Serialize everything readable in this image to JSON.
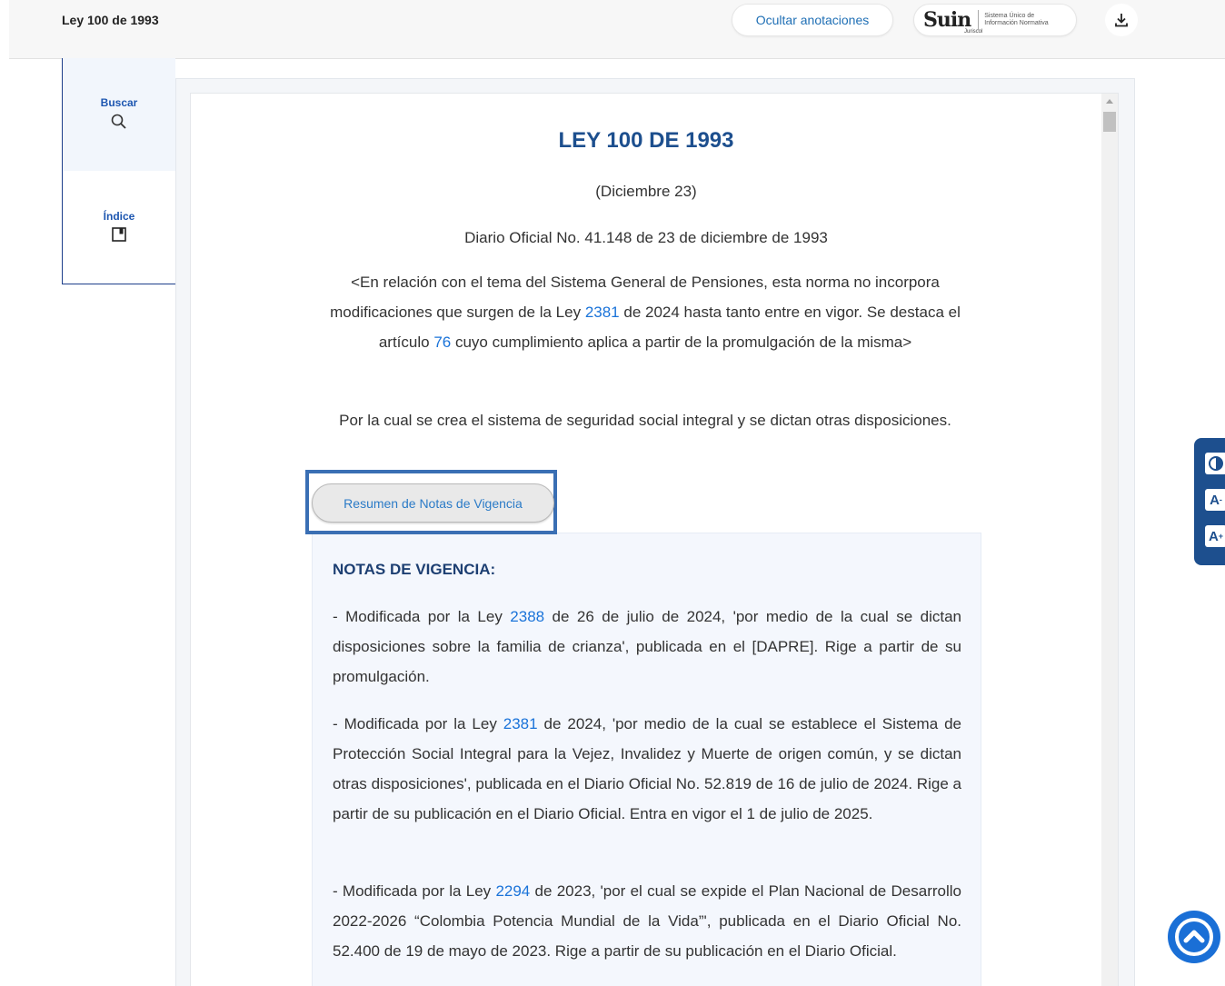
{
  "header": {
    "title": "Ley 100 de 1993",
    "ocultar_label": "Ocultar anotaciones",
    "suin_logo_text": "Suin",
    "suin_sub": "Juriscol",
    "suin_tagline_1": "Sistema Único de",
    "suin_tagline_2": "Información Normativa",
    "download_icon": "download-icon"
  },
  "sidebar": {
    "search_label": "Buscar",
    "index_label": "Índice"
  },
  "document": {
    "title": "LEY 100 DE 1993",
    "date": "(Diciembre 23)",
    "diario": "Diario Oficial No. 41.148 de 23 de diciembre de 1993",
    "relation": {
      "part1": "<En relación con el tema del Sistema General de Pensiones, esta norma no incorpora modificaciones que surgen de la Ley ",
      "link1": "2381",
      "part2": " de 2024 hasta tanto entre en vigor. Se destaca el artículo ",
      "link2": "76",
      "part3": " cuyo cumplimiento aplica a partir de la promulgación de la misma>"
    },
    "por_cual": "Por la cual se crea el sistema de seguridad social integral y se dictan otras disposiciones.",
    "resumen_label": "Resumen de Notas de Vigencia",
    "notes_title": "NOTAS DE VIGENCIA:",
    "notes": [
      {
        "pre": "- Modificada por la Ley ",
        "link": "2388",
        "post": " de 26 de julio de 2024, 'por medio de la cual se dictan disposiciones sobre la familia de crianza', publicada en el [DAPRE].  Rige a partir de su promulgación."
      },
      {
        "pre": "- Modificada por la Ley ",
        "link": "2381",
        "post": " de 2024, 'por medio de la cual se establece el Sistema de Protección Social Integral para la Vejez, Invalidez y Muerte de origen común, y se dictan otras disposiciones', publicada en el Diario Oficial No. 52.819 de 16 de julio de 2024. Rige a partir de su publicación en el Diario Oficial. Entra en vigor el 1 de julio de 2025."
      },
      {
        "pre": "- Modificada por la Ley ",
        "link": "2294",
        "post": " de 2023, 'por el cual se expide el Plan Nacional de Desarrollo 2022-2026 “Colombia Potencia Mundial de la Vida”', publicada en el Diario Oficial No. 52.400 de 19 de mayo de 2023.  Rige a partir de su publicación en el Diario Oficial."
      }
    ]
  },
  "a11y": {
    "contrast_icon": "contrast-icon",
    "decrease_label": "A",
    "increase_label": "A"
  },
  "colors": {
    "brand": "#1d4f8e",
    "link": "#1a73d9",
    "highlight_frame": "#3a6fb4"
  }
}
